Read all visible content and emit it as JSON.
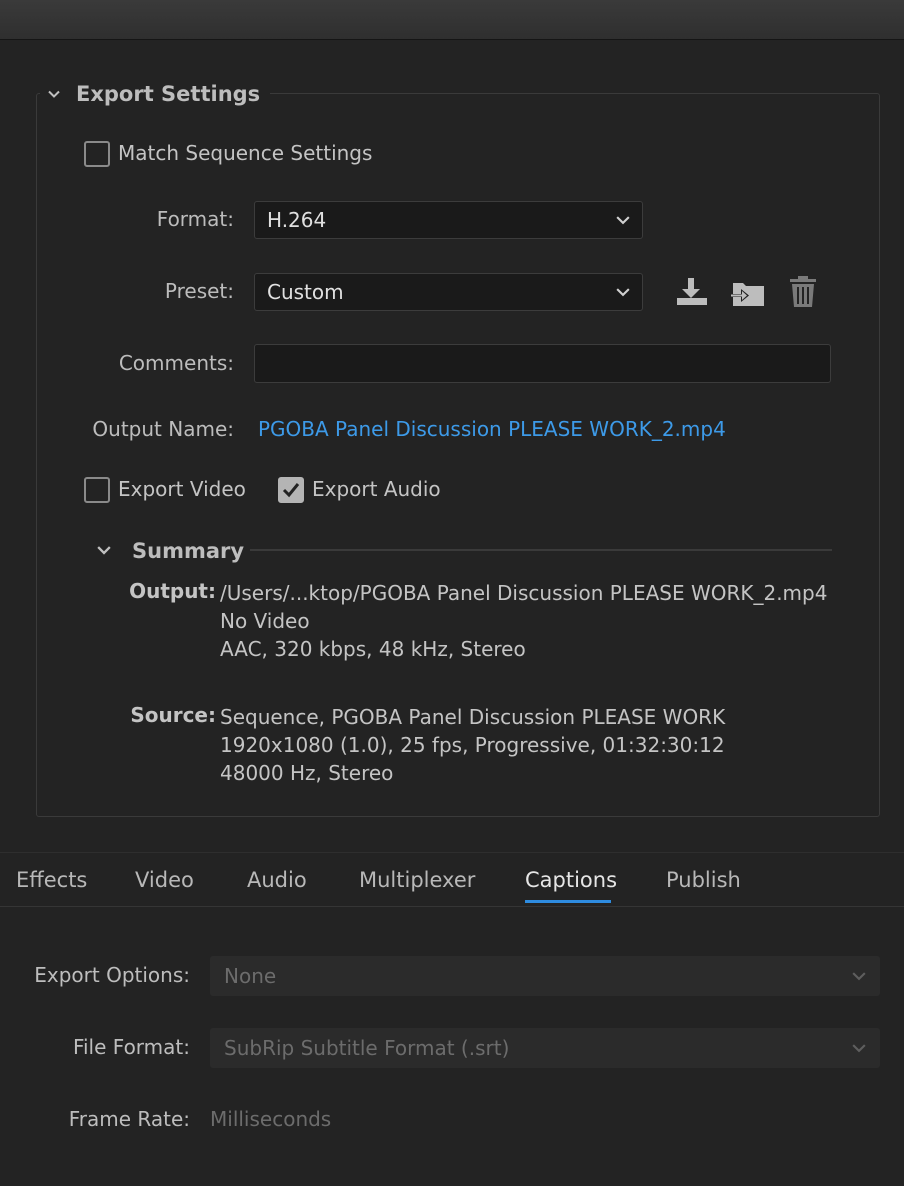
{
  "export_settings": {
    "title": "Export Settings",
    "match_sequence": {
      "label": "Match Sequence Settings",
      "checked": false
    },
    "format": {
      "label": "Format:",
      "value": "H.264"
    },
    "preset": {
      "label": "Preset:",
      "value": "Custom"
    },
    "comments": {
      "label": "Comments:",
      "value": ""
    },
    "output_name": {
      "label": "Output Name:",
      "value": "PGOBA Panel Discussion PLEASE WORK_2.mp4"
    },
    "export_video": {
      "label": "Export Video",
      "checked": false
    },
    "export_audio": {
      "label": "Export Audio",
      "checked": true
    }
  },
  "summary": {
    "title": "Summary",
    "output_label": "Output:",
    "output_lines": [
      "/Users/...ktop/PGOBA Panel Discussion PLEASE WORK_2.mp4",
      "No Video",
      "AAC, 320 kbps, 48 kHz, Stereo"
    ],
    "source_label": "Source:",
    "source_lines": [
      "Sequence, PGOBA Panel Discussion PLEASE WORK",
      "1920x1080 (1.0), 25 fps, Progressive, 01:32:30:12",
      "48000 Hz, Stereo"
    ]
  },
  "tabs": [
    {
      "label": "Effects"
    },
    {
      "label": "Video"
    },
    {
      "label": "Audio"
    },
    {
      "label": "Multiplexer"
    },
    {
      "label": "Captions"
    },
    {
      "label": "Publish"
    }
  ],
  "active_tab": "Captions",
  "captions": {
    "export_options": {
      "label": "Export Options:",
      "value": "None"
    },
    "file_format": {
      "label": "File Format:",
      "value": "SubRip Subtitle Format (.srt)"
    },
    "frame_rate": {
      "label": "Frame Rate:",
      "value": "Milliseconds"
    }
  },
  "colors": {
    "accent": "#2e8ce0",
    "link": "#3d9ae8",
    "background": "#232323"
  },
  "icons": [
    "chevron-down-icon",
    "save-preset-icon",
    "import-preset-icon",
    "delete-preset-icon",
    "checkmark-icon"
  ]
}
